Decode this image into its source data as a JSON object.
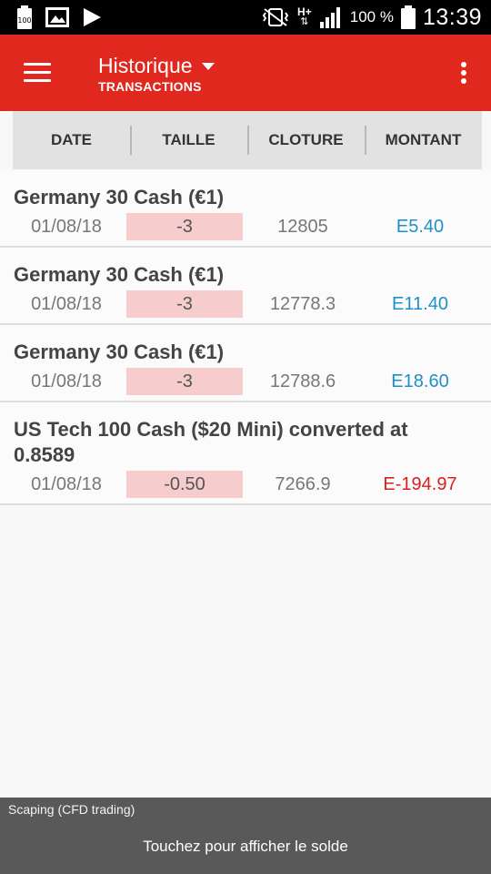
{
  "status_bar": {
    "icons_left": [
      "battery-saver-icon",
      "gallery-icon",
      "play-store-icon"
    ],
    "icons_right": [
      "vibrate-icon",
      "network-hplus-icon",
      "signal-icon",
      "battery-icon"
    ],
    "network_label": "H+",
    "battery_saver_label": "100",
    "battery_percent": "100 %",
    "time": "13:39"
  },
  "app_bar": {
    "title": "Historique",
    "subtitle": "TRANSACTIONS",
    "color": "#e0281e"
  },
  "columns": [
    "DATE",
    "TAILLE",
    "CLOTURE",
    "MONTANT"
  ],
  "transactions": [
    {
      "name": "Germany 30 Cash (€1)",
      "date": "01/08/18",
      "size": "-3",
      "close": "12805",
      "amount": "E5.40",
      "amount_color": "#1e90c8"
    },
    {
      "name": "Germany 30 Cash (€1)",
      "date": "01/08/18",
      "size": "-3",
      "close": "12778.3",
      "amount": "E11.40",
      "amount_color": "#1e90c8"
    },
    {
      "name": "Germany 30 Cash (€1)",
      "date": "01/08/18",
      "size": "-3",
      "close": "12788.6",
      "amount": "E18.60",
      "amount_color": "#1e90c8"
    },
    {
      "name": "US Tech 100 Cash ($20 Mini) converted at 0.8589",
      "date": "01/08/18",
      "size": "-0.50",
      "close": "7266.9",
      "amount": "E-194.97",
      "amount_color": "#d92020"
    }
  ],
  "bottom_bar": {
    "account_name": "Scaping (CFD trading)",
    "hint": "Touchez pour afficher le solde"
  }
}
